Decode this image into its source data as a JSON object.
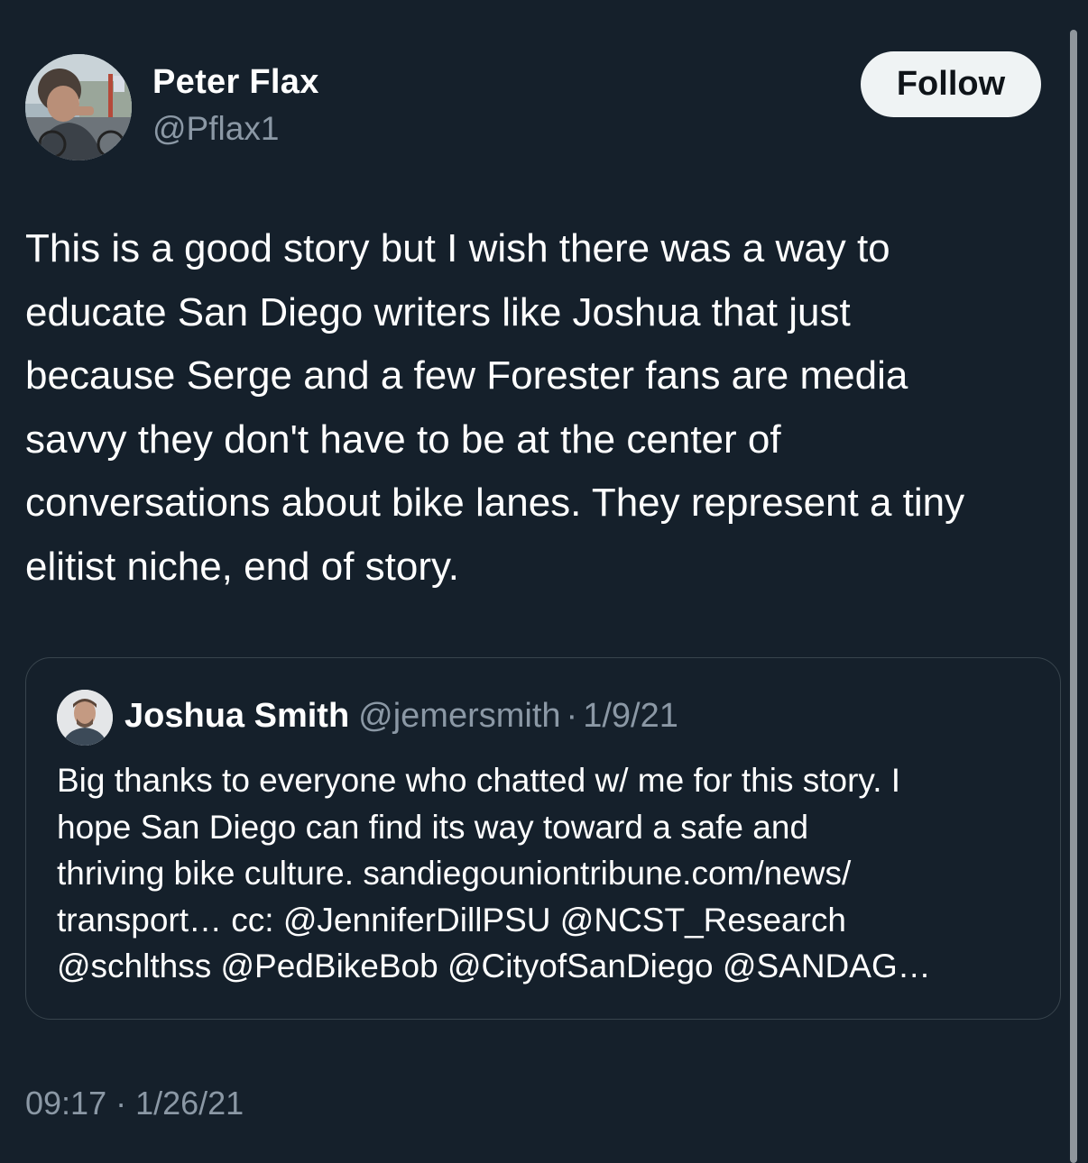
{
  "tweet": {
    "author": {
      "name": "Peter Flax",
      "handle": "@Pflax1"
    },
    "follow_label": "Follow",
    "text": "This is a good story but I wish there was a way to\neducate San Diego writers like Joshua that just\nbecause Serge and a few Forester fans are media\nsavvy they don't have to be at the center of\nconversations about bike lanes. They represent a tiny\nelitist niche, end of story.",
    "timestamp": "09:17 · 1/26/21"
  },
  "quoted": {
    "name": "Joshua Smith",
    "handle": "@jemersmith",
    "separator": "·",
    "date": "1/9/21",
    "text": "Big thanks to everyone who chatted w/ me for this story. I\nhope San Diego can find its way toward a safe and\nthriving bike culture. sandiegouniontribune.com/news/\ntransport… cc: @JenniferDillPSU @NCST_Research\n@schlthss @PedBikeBob @CityofSanDiego @SANDAG…"
  },
  "colors": {
    "background": "#15202b",
    "secondary_text": "#8b98a5",
    "border": "#38444d",
    "follow_button": "#eff3f4"
  }
}
